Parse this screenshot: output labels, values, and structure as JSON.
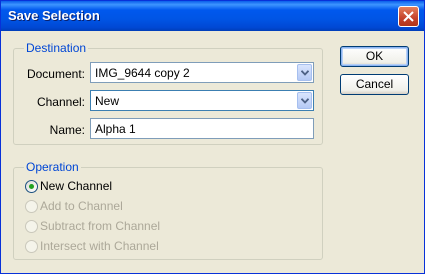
{
  "window": {
    "title": "Save Selection"
  },
  "destination": {
    "legend": "Destination",
    "document_label": "Document:",
    "document_value": "IMG_9644 copy 2",
    "channel_label": "Channel:",
    "channel_value": "New",
    "name_label": "Name:",
    "name_value": "Alpha 1"
  },
  "operation": {
    "legend": "Operation",
    "options": [
      {
        "label": "New Channel",
        "selected": true,
        "enabled": true
      },
      {
        "label": "Add to Channel",
        "selected": false,
        "enabled": false
      },
      {
        "label": "Subtract from Channel",
        "selected": false,
        "enabled": false
      },
      {
        "label": "Intersect with Channel",
        "selected": false,
        "enabled": false
      }
    ]
  },
  "buttons": {
    "ok_label": "OK",
    "cancel_label": "Cancel"
  },
  "icons": {
    "close": "close-icon",
    "dropdown": "chevron-down-icon"
  },
  "colors": {
    "title_bar": "#0058ee",
    "legend_text": "#0046d5",
    "close_button": "#c4422a",
    "radio_dot": "#21a121"
  }
}
